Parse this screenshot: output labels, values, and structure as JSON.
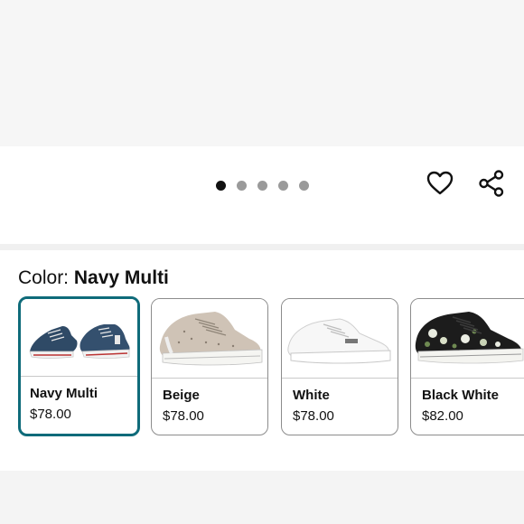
{
  "gallery": {
    "slide_count": 5,
    "active_slide": 1
  },
  "actions": {
    "favorite_icon": "heart-outline-icon",
    "share_icon": "share-icon"
  },
  "color_picker": {
    "label": "Color:",
    "selected": "Navy Multi",
    "options": [
      {
        "name": "Navy Multi",
        "price": "$78.00",
        "selected": true
      },
      {
        "name": "Beige",
        "price": "$78.00",
        "selected": false
      },
      {
        "name": "White",
        "price": "$78.00",
        "selected": false
      },
      {
        "name": "Black White",
        "price": "$82.00",
        "selected": false
      }
    ]
  },
  "colors": {
    "selected_border": "#0f6b7a",
    "dot_active": "#111111",
    "dot_inactive": "#9a9a9a"
  }
}
